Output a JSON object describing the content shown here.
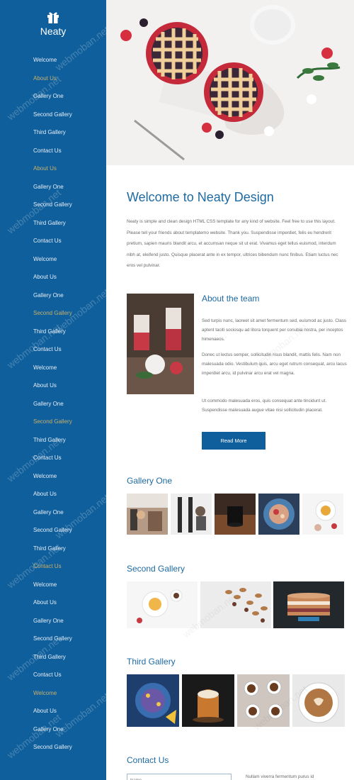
{
  "sidebar": {
    "brand": "Neaty",
    "nav": [
      {
        "label": "Welcome",
        "active": false
      },
      {
        "label": "About Us",
        "active": true
      },
      {
        "label": "Gallery One",
        "active": false
      },
      {
        "label": "Second Gallery",
        "active": false
      },
      {
        "label": "Third Gallery",
        "active": false
      },
      {
        "label": "Contact Us",
        "active": false
      },
      {
        "label": "About Us",
        "active": true
      },
      {
        "label": "Gallery One",
        "active": false
      },
      {
        "label": "Second Gallery",
        "active": false
      },
      {
        "label": "Third Gallery",
        "active": false
      },
      {
        "label": "Contact Us",
        "active": false
      },
      {
        "label": "Welcome",
        "active": false
      },
      {
        "label": "About Us",
        "active": false
      },
      {
        "label": "Gallery One",
        "active": false
      },
      {
        "label": "Second Gallery",
        "active": true
      },
      {
        "label": "Third Gallery",
        "active": false
      },
      {
        "label": "Contact Us",
        "active": false
      },
      {
        "label": "Welcome",
        "active": false
      },
      {
        "label": "About Us",
        "active": false
      },
      {
        "label": "Gallery One",
        "active": false
      },
      {
        "label": "Second Gallery",
        "active": true
      },
      {
        "label": "Third Gallery",
        "active": false
      },
      {
        "label": "Contact Us",
        "active": false
      },
      {
        "label": "Welcome",
        "active": false
      },
      {
        "label": "About Us",
        "active": false
      },
      {
        "label": "Gallery One",
        "active": false
      },
      {
        "label": "Second Gallery",
        "active": false
      },
      {
        "label": "Third Gallery",
        "active": false
      },
      {
        "label": "Contact Us",
        "active": true
      },
      {
        "label": "Welcome",
        "active": false
      },
      {
        "label": "About Us",
        "active": false
      },
      {
        "label": "Gallery One",
        "active": false
      },
      {
        "label": "Second Gallery",
        "active": false
      },
      {
        "label": "Third Gallery",
        "active": false
      },
      {
        "label": "Contact Us",
        "active": false
      },
      {
        "label": "Welcome",
        "active": true
      },
      {
        "label": "About Us",
        "active": false
      },
      {
        "label": "Gallery One",
        "active": false
      },
      {
        "label": "Second Gallery",
        "active": false
      }
    ]
  },
  "welcome": {
    "title": "Welcome to Neaty Design",
    "text": "Neaty is simple and clean design HTML CSS template for any kind of website. Feel free to use this layout. Please tell your friends about templatemo website. Thank you. Suspendisse imperdiet, felis eu hendrerit pretium, sapien mauris blandit arcu, et accumsan neque sit ut erat. Vivamus eget tellus euismod, interdum nibh at, eleifend justo. Quisque placerat ante in ex tempor, ultrices bibendum nunc finibus. Etiam luctus nec eros vel pulvinar."
  },
  "team": {
    "title": "About the team",
    "p1": "Sed turpis nunc, laoreet sit amet fermentum sed, euismod ac justo. Class aptent taciti sociosqu ad litora torquent per conubia nostra, per inceptos himenaeos.",
    "p2": "Donec ut lectus semper, sollicitudin risus blandit, mattis felis. Nam non malesuada odio. Vestibulum quis, arcu eget rutrum consequat, arcu lacus imperdiet arcu, id pulvinar arcu erat vel magna.",
    "p3": "Ut commodo malesuada eros, quis consequat ante tincidunt ut. Suspendisse malesuada augue vitae nisi sollicitudin placerat.",
    "button": "Read More"
  },
  "galleries": {
    "one": "Gallery One",
    "two": "Second Gallery",
    "three": "Third Gallery"
  },
  "contact": {
    "title": "Contact Us",
    "name_placeholder": "Name",
    "text": "Nullam viverra fermentum purus id"
  },
  "watermark": "webmoban.net",
  "colors": {
    "sidebar": "#0f5f9c",
    "accent": "#1d6aa3",
    "active_nav": "#c8b06a",
    "button": "#0f5f9c"
  }
}
